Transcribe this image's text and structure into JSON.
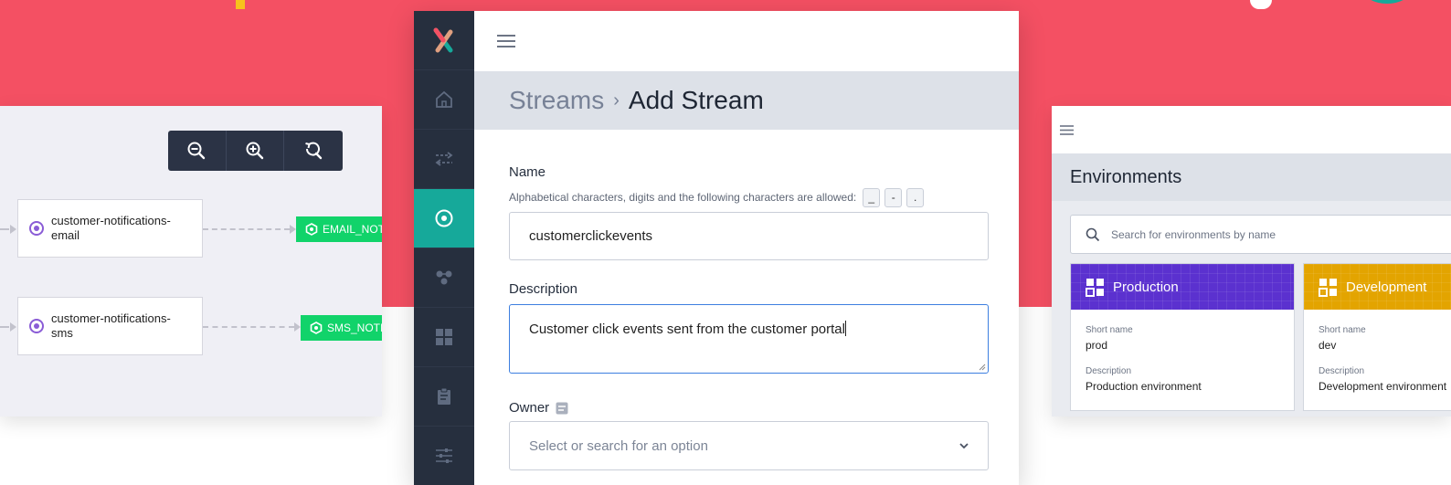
{
  "colors": {
    "hero": "#f45063",
    "sidebar": "#262f3e",
    "sidebar_active": "#16a99a",
    "topic": "#11d36a",
    "production": "#5b31cf",
    "development": "#e3a400",
    "focus_border": "#3d7fe0"
  },
  "topology": {
    "nodes": [
      {
        "label": "customer-notifications-email",
        "icon": "stream-node-icon"
      },
      {
        "label": "customer-notifications-sms",
        "icon": "stream-node-icon"
      }
    ],
    "topics": [
      {
        "label": "EMAIL_NOT",
        "icon": "topic-hexagon-icon"
      },
      {
        "label": "SMS_NOTI",
        "icon": "topic-hexagon-icon"
      }
    ],
    "zoom_controls": [
      "zoom-out-icon",
      "zoom-in-icon",
      "reset-zoom-icon"
    ]
  },
  "app": {
    "sidebar_icons": [
      "logo-icon",
      "home-icon",
      "transfer-icon",
      "streams-icon",
      "connections-icon",
      "dashboard-icon",
      "clipboard-icon",
      "settings-sliders-icon"
    ],
    "breadcrumb": {
      "parent": "Streams",
      "separator": "›",
      "current": "Add Stream"
    },
    "form": {
      "name_label": "Name",
      "name_help": "Alphabetical characters, digits and the following characters are allowed:",
      "allowed_chars": [
        "_",
        "-",
        "."
      ],
      "name_value": "customerclickevents",
      "description_label": "Description",
      "description_value": "Customer click events sent from the customer portal",
      "owner_label": "Owner",
      "owner_placeholder": "Select or search for an option"
    }
  },
  "environments": {
    "title": "Environments",
    "search_placeholder": "Search for environments by name",
    "short_name_label": "Short name",
    "description_label": "Description",
    "cards": [
      {
        "name": "Production",
        "short_name": "prod",
        "description": "Production environment"
      },
      {
        "name": "Development",
        "short_name": "dev",
        "description": "Development environment"
      }
    ]
  }
}
